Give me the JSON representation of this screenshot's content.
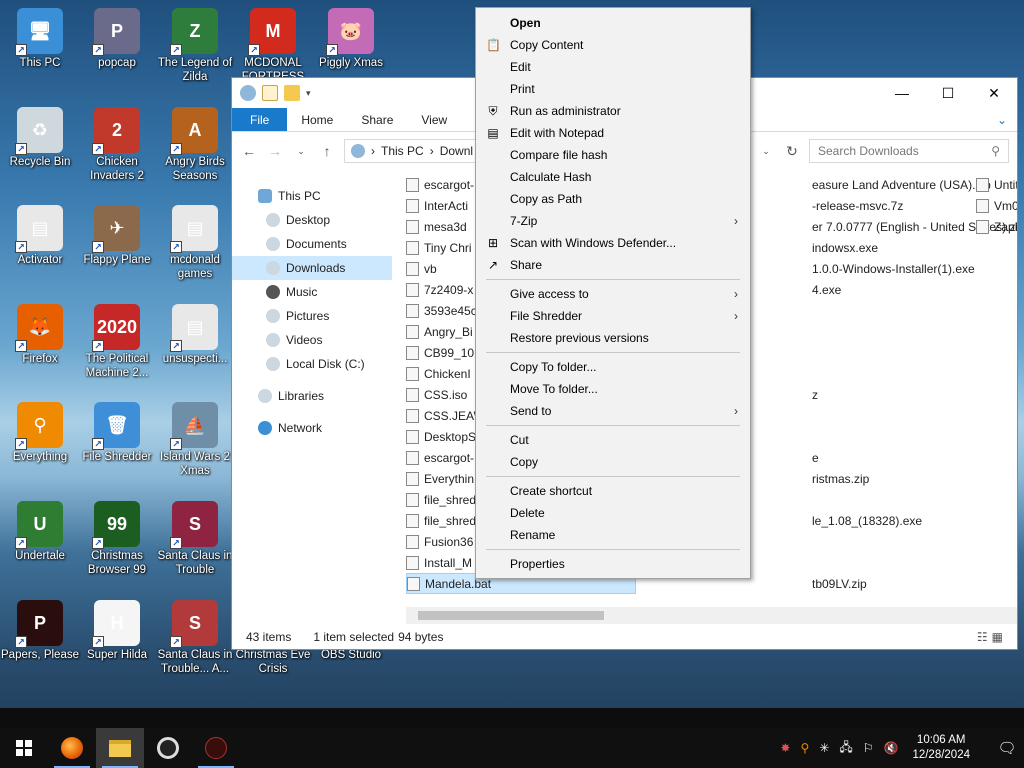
{
  "desktop": {
    "icons": [
      {
        "label": "This PC",
        "glyph": "🖥",
        "color": "#3b8fd6"
      },
      {
        "label": "popcap",
        "glyph": "P",
        "color": "#6a6a8a"
      },
      {
        "label": "The Legend of Zilda",
        "glyph": "Z",
        "color": "#2f7d3c"
      },
      {
        "label": "MCDONAL FORTRESS",
        "glyph": "M",
        "color": "#d22b1e"
      },
      {
        "label": "Piggly Xmas",
        "glyph": "🐷",
        "color": "#c46bb8"
      },
      {
        "label": "Recycle Bin",
        "glyph": "♻",
        "color": "#cfd8dc"
      },
      {
        "label": "Chicken Invaders 2",
        "glyph": "2",
        "color": "#c0392b"
      },
      {
        "label": "Angry Birds Seasons",
        "glyph": "A",
        "color": "#b5621f"
      },
      {
        "label": "Activator",
        "glyph": "▤",
        "color": "#e8e8e8"
      },
      {
        "label": "Flappy Plane",
        "glyph": "✈",
        "color": "#8a6a4a"
      },
      {
        "label": "mcdonald games",
        "glyph": "▤",
        "color": "#e8e8e8"
      },
      {
        "label": "Firefox",
        "glyph": "🦊",
        "color": "#e66000"
      },
      {
        "label": "The Political Machine 2...",
        "glyph": "2020",
        "color": "#c62828"
      },
      {
        "label": "unsuspecti...",
        "glyph": "▤",
        "color": "#e8e8e8"
      },
      {
        "label": "Everything",
        "glyph": "⚲",
        "color": "#f08a00"
      },
      {
        "label": "File Shredder",
        "glyph": "🗑",
        "color": "#3f8fd8"
      },
      {
        "label": "Island Wars 2 Xmas",
        "glyph": "⛵",
        "color": "#6f8fa8"
      },
      {
        "label": "Undertale",
        "glyph": "U",
        "color": "#2e7d32"
      },
      {
        "label": "Christmas Browser 99",
        "glyph": "99",
        "color": "#1b5e20"
      },
      {
        "label": "Santa Claus in Trouble",
        "glyph": "S",
        "color": "#8e2442"
      },
      {
        "label": "Papers, Please",
        "glyph": "P",
        "color": "#2a0e0e"
      },
      {
        "label": "Super Hilda",
        "glyph": "H",
        "color": "#f5f5f5"
      },
      {
        "label": "Santa Claus in Trouble... A...",
        "glyph": "S",
        "color": "#b23a3a"
      },
      {
        "label": "Christmas Eve Crisis",
        "glyph": "",
        "color": "transparent"
      },
      {
        "label": "OBS Studio",
        "glyph": "",
        "color": "transparent"
      }
    ]
  },
  "explorer": {
    "tabs": {
      "file": "File",
      "home": "Home",
      "share": "Share",
      "view": "View"
    },
    "address": {
      "this_pc": "This PC",
      "sep": "›",
      "current": "Downl"
    },
    "search_placeholder": "Search Downloads",
    "nav": {
      "this_pc": "This PC",
      "desktop": "Desktop",
      "documents": "Documents",
      "downloads": "Downloads",
      "music": "Music",
      "pictures": "Pictures",
      "videos": "Videos",
      "local_disk": "Local Disk (C:)",
      "libraries": "Libraries",
      "network": "Network"
    },
    "files_col1": [
      "escargot-",
      "InterActi",
      "mesa3d",
      "Tiny Chri",
      "vb",
      "7z2409-x",
      "3593e45c",
      "Angry_Bi",
      "CB99_10.",
      "ChickenI",
      "CSS.iso",
      "CSS.JEAW",
      "DesktopS",
      "escargot-",
      "Everythin",
      "file_shred",
      "file_shred",
      "Fusion36",
      "Install_M",
      "Mandela.bat"
    ],
    "files_col2": [
      {
        "name": "easure Land Adventure (USA).zip",
        "row": 0
      },
      {
        "name": "-release-msvc.7z",
        "row": 1
      },
      {
        "name": "er 7.0.0777 (English - United States).zip",
        "row": 2
      },
      {
        "name": "indowsx.exe",
        "row": 3
      },
      {
        "name": "1.0.0-Windows-Installer(1).exe",
        "row": 4
      },
      {
        "name": "4.exe",
        "row": 5
      },
      {
        "name": "z",
        "row": 10
      },
      {
        "name": "e",
        "row": 13
      },
      {
        "name": "ristmas.zip",
        "row": 14
      },
      {
        "name": "le_1.08_(18328).exe",
        "row": 16
      },
      {
        "name": "tb09LV.zip",
        "row": 19
      }
    ],
    "files_col3": [
      "Untit",
      "Vm0",
      "ZapN"
    ],
    "status": {
      "count": "43 items",
      "selected": "1 item selected",
      "size": "94 bytes"
    }
  },
  "context_menu": {
    "groups": [
      [
        {
          "label": "Open",
          "bold": true,
          "icon": ""
        },
        {
          "label": "Copy Content",
          "icon": "clipboard-icon"
        },
        {
          "label": "Edit",
          "icon": ""
        },
        {
          "label": "Print",
          "icon": ""
        },
        {
          "label": "Run as administrator",
          "icon": "shield-icon"
        },
        {
          "label": "Edit with Notepad",
          "icon": "notepad-icon"
        },
        {
          "label": "Compare file hash",
          "icon": ""
        },
        {
          "label": "Calculate Hash",
          "icon": ""
        },
        {
          "label": "Copy as Path",
          "icon": ""
        },
        {
          "label": "7-Zip",
          "icon": "",
          "submenu": true
        },
        {
          "label": "Scan with Windows Defender...",
          "icon": "defender-icon"
        },
        {
          "label": "Share",
          "icon": "share-icon"
        }
      ],
      [
        {
          "label": "Give access to",
          "icon": "",
          "submenu": true
        },
        {
          "label": "File Shredder",
          "icon": "",
          "submenu": true
        },
        {
          "label": "Restore previous versions",
          "icon": ""
        }
      ],
      [
        {
          "label": "Copy To folder...",
          "icon": ""
        },
        {
          "label": "Move To folder...",
          "icon": ""
        },
        {
          "label": "Send to",
          "icon": "",
          "submenu": true
        }
      ],
      [
        {
          "label": "Cut",
          "icon": ""
        },
        {
          "label": "Copy",
          "icon": ""
        }
      ],
      [
        {
          "label": "Create shortcut",
          "icon": ""
        },
        {
          "label": "Delete",
          "icon": ""
        },
        {
          "label": "Rename",
          "icon": ""
        }
      ],
      [
        {
          "label": "Properties",
          "icon": ""
        }
      ]
    ]
  },
  "taskbar": {
    "time": "10:06 AM",
    "date": "12/28/2024"
  }
}
